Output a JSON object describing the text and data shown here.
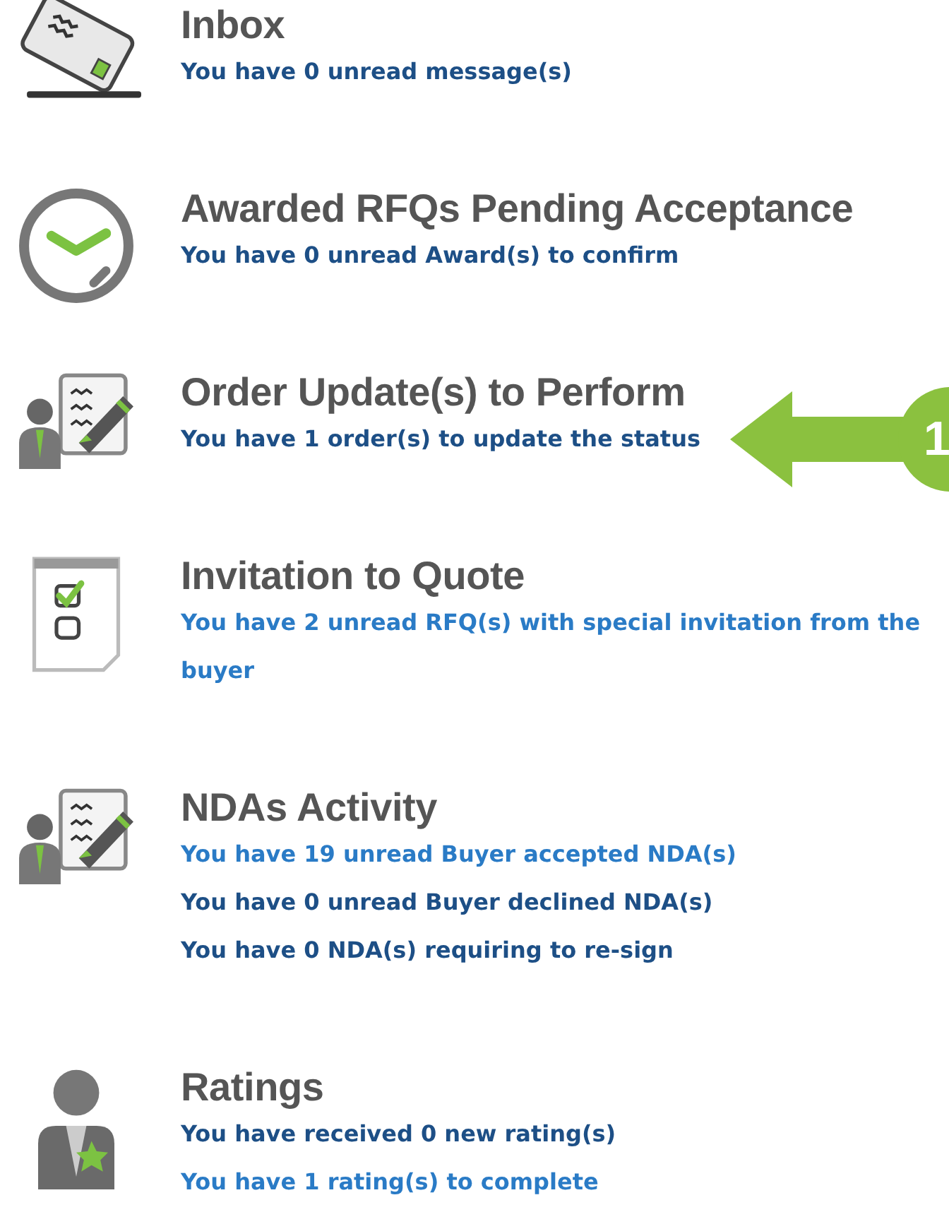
{
  "sections": [
    {
      "kind": "inbox",
      "title": "Inbox",
      "lines": [
        {
          "text": "You have 0 unread message(s)",
          "visited": true
        }
      ]
    },
    {
      "kind": "clock",
      "title": "Awarded RFQs Pending Acceptance",
      "lines": [
        {
          "text": "You have 0 unread Award(s) to confirm",
          "visited": true
        }
      ]
    },
    {
      "kind": "contract",
      "title": "Order Update(s) to Perform",
      "lines": [
        {
          "text": "You have 1 order(s) to update the status",
          "visited": true
        }
      ],
      "callout": {
        "number": "1"
      }
    },
    {
      "kind": "checklist",
      "title": "Invitation to Quote",
      "lines": [
        {
          "text": "You have 2 unread RFQ(s) with special invitation from the buyer",
          "visited": false
        }
      ]
    },
    {
      "kind": "contract",
      "title": "NDAs Activity",
      "lines": [
        {
          "text": "You have 19 unread Buyer accepted NDA(s)",
          "visited": false
        },
        {
          "text": "You have 0 unread Buyer declined NDA(s)",
          "visited": true
        },
        {
          "text": "You have 0 NDA(s) requiring to re-sign",
          "visited": true
        }
      ]
    },
    {
      "kind": "person",
      "title": "Ratings",
      "lines": [
        {
          "text": "You have received 0 new rating(s)",
          "visited": true
        },
        {
          "text": "You have 1 rating(s) to complete",
          "visited": false
        }
      ]
    }
  ]
}
